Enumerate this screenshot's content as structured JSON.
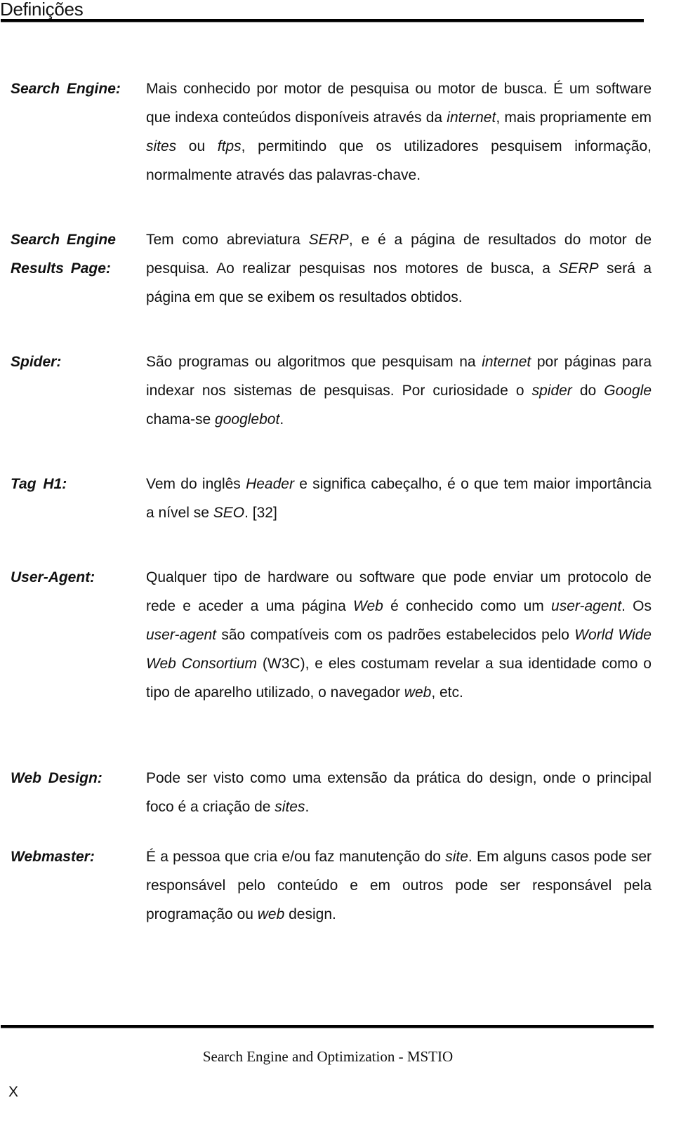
{
  "header": {
    "title": "Definições"
  },
  "entries": [
    {
      "term": "Search Engine:",
      "definition": [
        {
          "t": "Mais conhecido por motor de pesquisa ou motor de busca. É um software que indexa conteúdos disponíveis através da "
        },
        {
          "t": "internet",
          "i": true
        },
        {
          "t": ", mais propriamente em "
        },
        {
          "t": "sites",
          "i": true
        },
        {
          "t": " ou "
        },
        {
          "t": "ftps",
          "i": true
        },
        {
          "t": ", permitindo que os utilizadores pesquisem informação, normalmente através das palavras-chave."
        }
      ]
    },
    {
      "term": "Search Engine Results Page:",
      "definition": [
        {
          "t": "Tem como abreviatura "
        },
        {
          "t": "SERP",
          "i": true
        },
        {
          "t": ", e é a página de resultados do motor de pesquisa. Ao realizar pesquisas nos motores de busca, a "
        },
        {
          "t": "SERP",
          "i": true
        },
        {
          "t": " será a página em que se exibem os resultados obtidos."
        }
      ]
    },
    {
      "term": "Spider:",
      "definition": [
        {
          "t": "São programas ou algoritmos que pesquisam na "
        },
        {
          "t": "internet",
          "i": true
        },
        {
          "t": " por páginas para indexar nos sistemas de pesquisas. Por curiosidade o "
        },
        {
          "t": "spider",
          "i": true
        },
        {
          "t": " do "
        },
        {
          "t": "Google",
          "i": true
        },
        {
          "t": " chama-se "
        },
        {
          "t": "googlebot",
          "i": true
        },
        {
          "t": "."
        }
      ]
    },
    {
      "term": "Tag H1:",
      "definition": [
        {
          "t": "Vem do inglês "
        },
        {
          "t": "Header",
          "i": true
        },
        {
          "t": " e significa cabeçalho, é o que tem maior importância a nível se "
        },
        {
          "t": "SEO",
          "i": true
        },
        {
          "t": ". [32]"
        }
      ]
    },
    {
      "term": "User-Agent:",
      "definition": [
        {
          "t": "Qualquer tipo de hardware ou software que pode enviar um protocolo de rede e aceder a uma página "
        },
        {
          "t": "Web",
          "i": true
        },
        {
          "t": " é conhecido como um "
        },
        {
          "t": "user-agent",
          "i": true
        },
        {
          "t": ". Os "
        },
        {
          "t": "user-agent",
          "i": true
        },
        {
          "t": " são compatíveis com os padrões estabelecidos pelo "
        },
        {
          "t": "World Wide Web Consortium",
          "i": true
        },
        {
          "t": " (W3C), e eles costumam revelar a sua identidade como o tipo de aparelho utilizado, o navegador "
        },
        {
          "t": "web",
          "i": true
        },
        {
          "t": ", etc."
        }
      ]
    },
    {
      "term": "Web Design:",
      "definition": [
        {
          "t": "Pode ser visto como uma extensão da prática do design, onde o principal foco é a criação de "
        },
        {
          "t": "sites",
          "i": true
        },
        {
          "t": "."
        }
      ]
    },
    {
      "term": "Webmaster:",
      "definition": [
        {
          "t": "É a pessoa que cria e/ou faz manutenção do "
        },
        {
          "t": "site",
          "i": true
        },
        {
          "t": ". Em alguns casos pode ser responsável pelo conteúdo e em outros pode ser responsável pela programação ou "
        },
        {
          "t": "web",
          "i": true
        },
        {
          "t": " design."
        }
      ]
    }
  ],
  "footer": {
    "text": "Search Engine and Optimization - MSTIO",
    "page_number": "X"
  }
}
